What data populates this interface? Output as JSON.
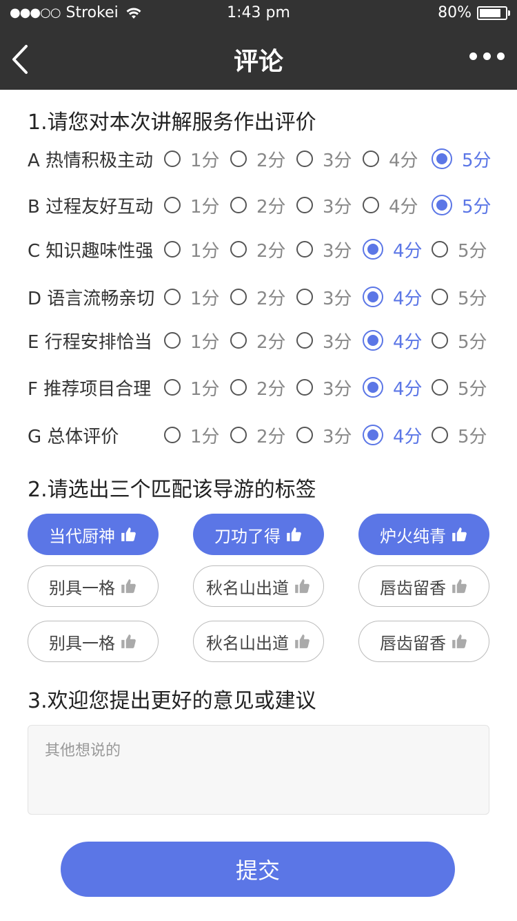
{
  "status_bar": {
    "signal": "●●●○○",
    "carrier": "Strokei",
    "time": "1:43 pm",
    "battery": "80%"
  },
  "nav": {
    "title": "评论",
    "back_icon": "chevron-left-icon",
    "more_icon": "more-dots-icon"
  },
  "section1": {
    "title": "1.请您对本次讲解服务作出评价",
    "options": [
      "1分",
      "2分",
      "3分",
      "4分",
      "5分"
    ],
    "rows": [
      {
        "label": "A 热情积极主动",
        "selected": 5
      },
      {
        "label": "B 过程友好互动",
        "selected": 5
      },
      {
        "label": "C 知识趣味性强",
        "selected": 4
      },
      {
        "label": "D 语言流畅亲切",
        "selected": 4
      },
      {
        "label": "E 行程安排恰当",
        "selected": 4
      },
      {
        "label": "F 推荐项目合理",
        "selected": 4
      },
      {
        "label": "G 总体评价",
        "selected": 4
      }
    ]
  },
  "section2": {
    "title": "2.请选出三个匹配该导游的标签",
    "tags": [
      {
        "label": "当代厨神",
        "selected": true
      },
      {
        "label": "刀功了得",
        "selected": true
      },
      {
        "label": "炉火纯青",
        "selected": true
      },
      {
        "label": "别具一格",
        "selected": false
      },
      {
        "label": "秋名山出道",
        "selected": false
      },
      {
        "label": "唇齿留香",
        "selected": false
      },
      {
        "label": "别具一格",
        "selected": false
      },
      {
        "label": "秋名山出道",
        "selected": false
      },
      {
        "label": "唇齿留香",
        "selected": false
      }
    ]
  },
  "section3": {
    "title": "3.欢迎您提出更好的意见或建议",
    "placeholder": "其他想说的",
    "value": ""
  },
  "submit_label": "提交",
  "colors": {
    "accent": "#5b76e6",
    "header_bg": "#333333"
  }
}
